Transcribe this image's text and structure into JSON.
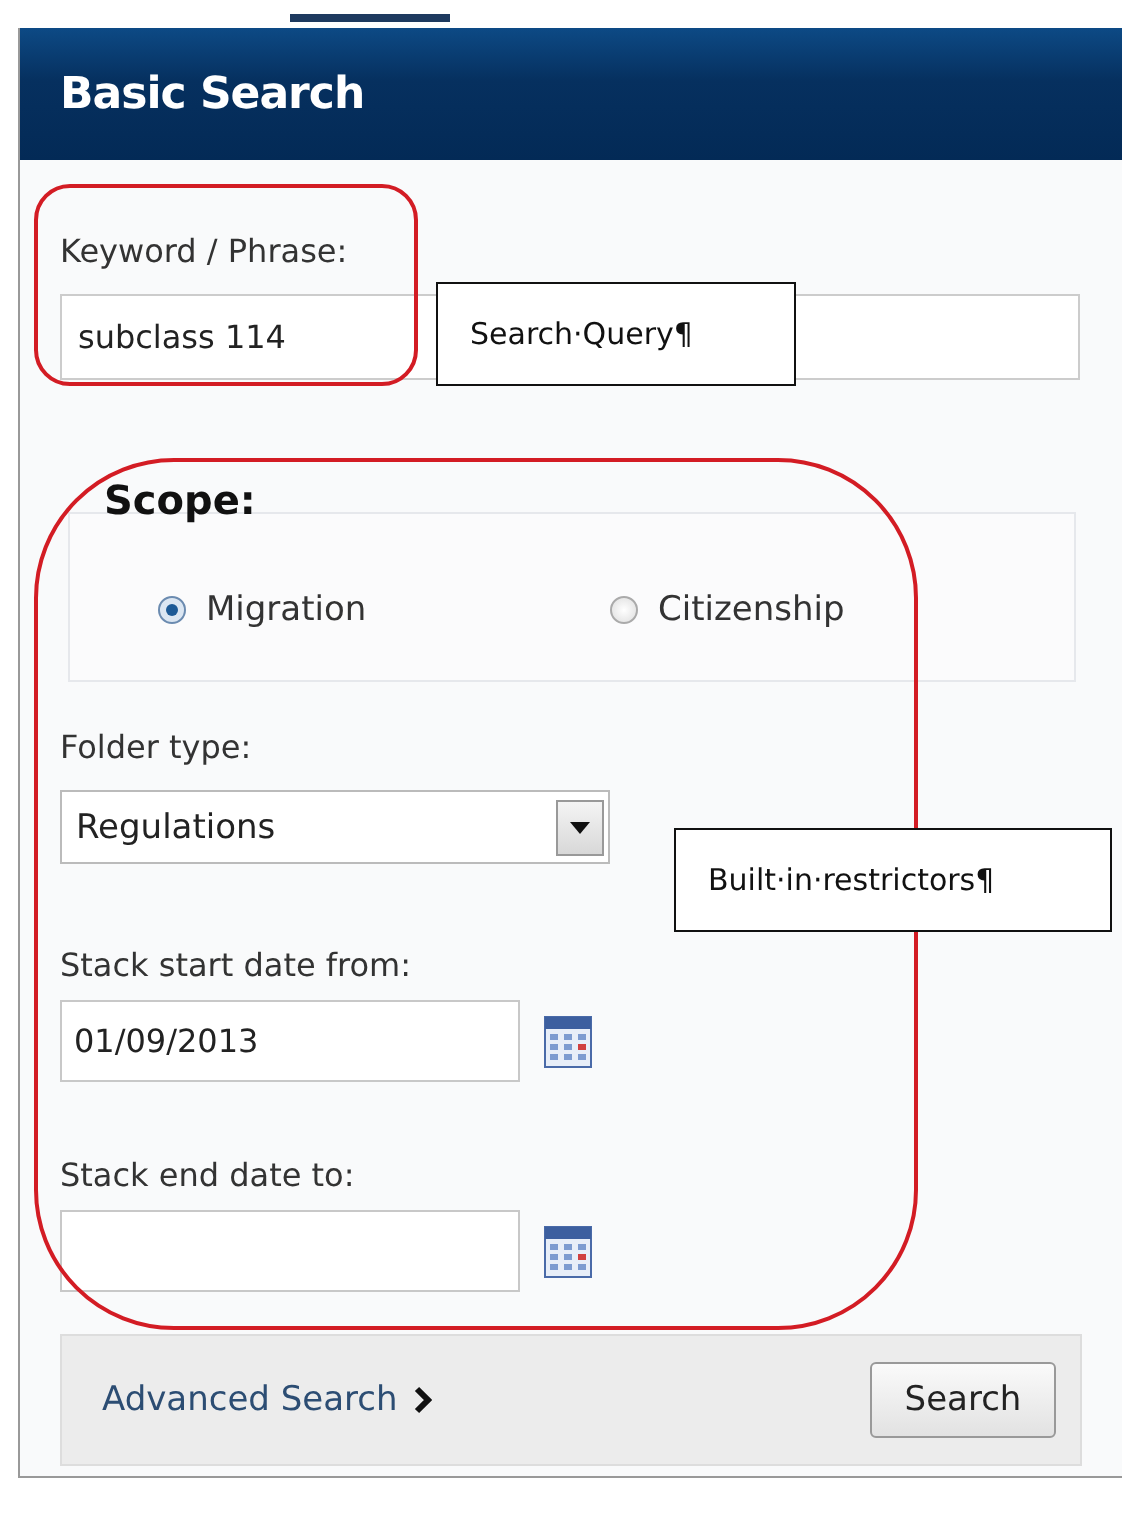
{
  "panel": {
    "title": "Basic Search"
  },
  "keyword": {
    "label": "Keyword / Phrase:",
    "value": "subclass 114"
  },
  "scope": {
    "title": "Scope:",
    "options": [
      {
        "label": "Migration",
        "selected": true
      },
      {
        "label": "Citizenship",
        "selected": false
      }
    ]
  },
  "folder_type": {
    "label": "Folder type:",
    "value": "Regulations"
  },
  "start_date": {
    "label": "Stack start date from:",
    "value": "01/09/2013"
  },
  "end_date": {
    "label": "Stack end date to:"
  },
  "footer": {
    "link": "Advanced Search",
    "button": "Search"
  },
  "annotations": [
    {
      "text": "Search·Query¶"
    },
    {
      "text": "Built·in·restrictors¶"
    }
  ]
}
